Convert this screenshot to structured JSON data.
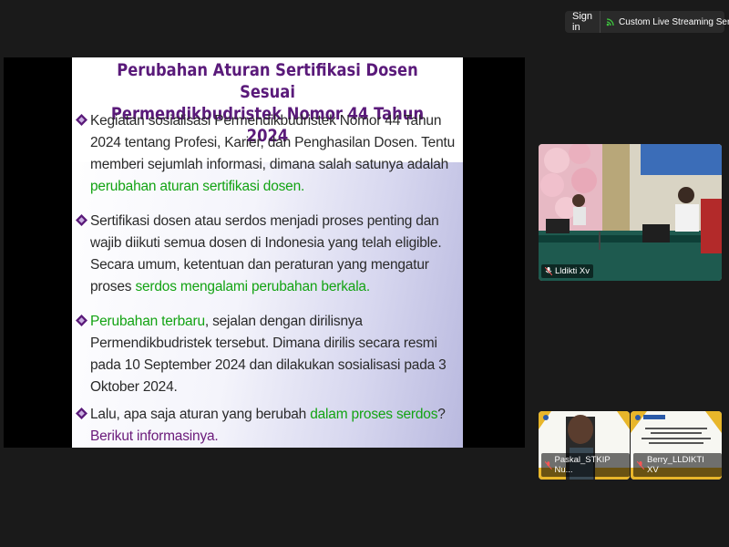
{
  "topbar": {
    "signin_label": "Sign in",
    "stream_label": "Custom Live Streaming Service"
  },
  "slide": {
    "title_line1": "Perubahan Aturan Sertifikasi Dosen Sesuai",
    "title_line2": "Permendikbudristek Nomor 44 Tahun 2024",
    "bullet1_a": "Kegiatan sosialisasi Permendikbudristek Nomor 44 Tahun 2024 tentang Profesi, Karier, dan Penghasilan Dosen. Tentu memberi sejumlah informasi, dimana salah satunya adalah ",
    "bullet1_b": "perubahan aturan sertifikasi dosen.",
    "bullet2_a": "Sertifikasi dosen atau serdos menjadi proses penting dan wajib diikuti semua dosen di Indonesia yang telah eligible. Secara umum, ketentuan dan peraturan yang mengatur proses ",
    "bullet2_b": "serdos mengalami perubahan berkala.",
    "bullet3_a": "Perubahan terbaru",
    "bullet3_b": ", sejalan dengan dirilisnya Permendikbudristek tersebut. Dimana dirilis secara resmi pada 10 September 2024 dan dilakukan sosialisasi pada 3 Oktober 2024.",
    "bullet4_a": "Lalu, apa saja aturan yang berubah ",
    "bullet4_b": "dalam proses serdos",
    "bullet4_c": "? ",
    "bullet4_d": "Berikut informasinya."
  },
  "participants": {
    "main_name": "Lldikti Xv",
    "small1_name": "Paskal_STKIP Nu...",
    "small2_name": "Berry_LLDIKTI XV",
    "banner_logo": "LLDikti",
    "banner_text": "DISEMINASI PERMENDIKBUDRISTEK NOMOR 44 TAHUN 2024 TENTANG PROFESI, KARIR, DAN PENGHASILAN DOSEN"
  },
  "colors": {
    "title": "#5a1a7a",
    "highlight_green": "#13a313",
    "highlight_purple": "#6a1a7a"
  }
}
